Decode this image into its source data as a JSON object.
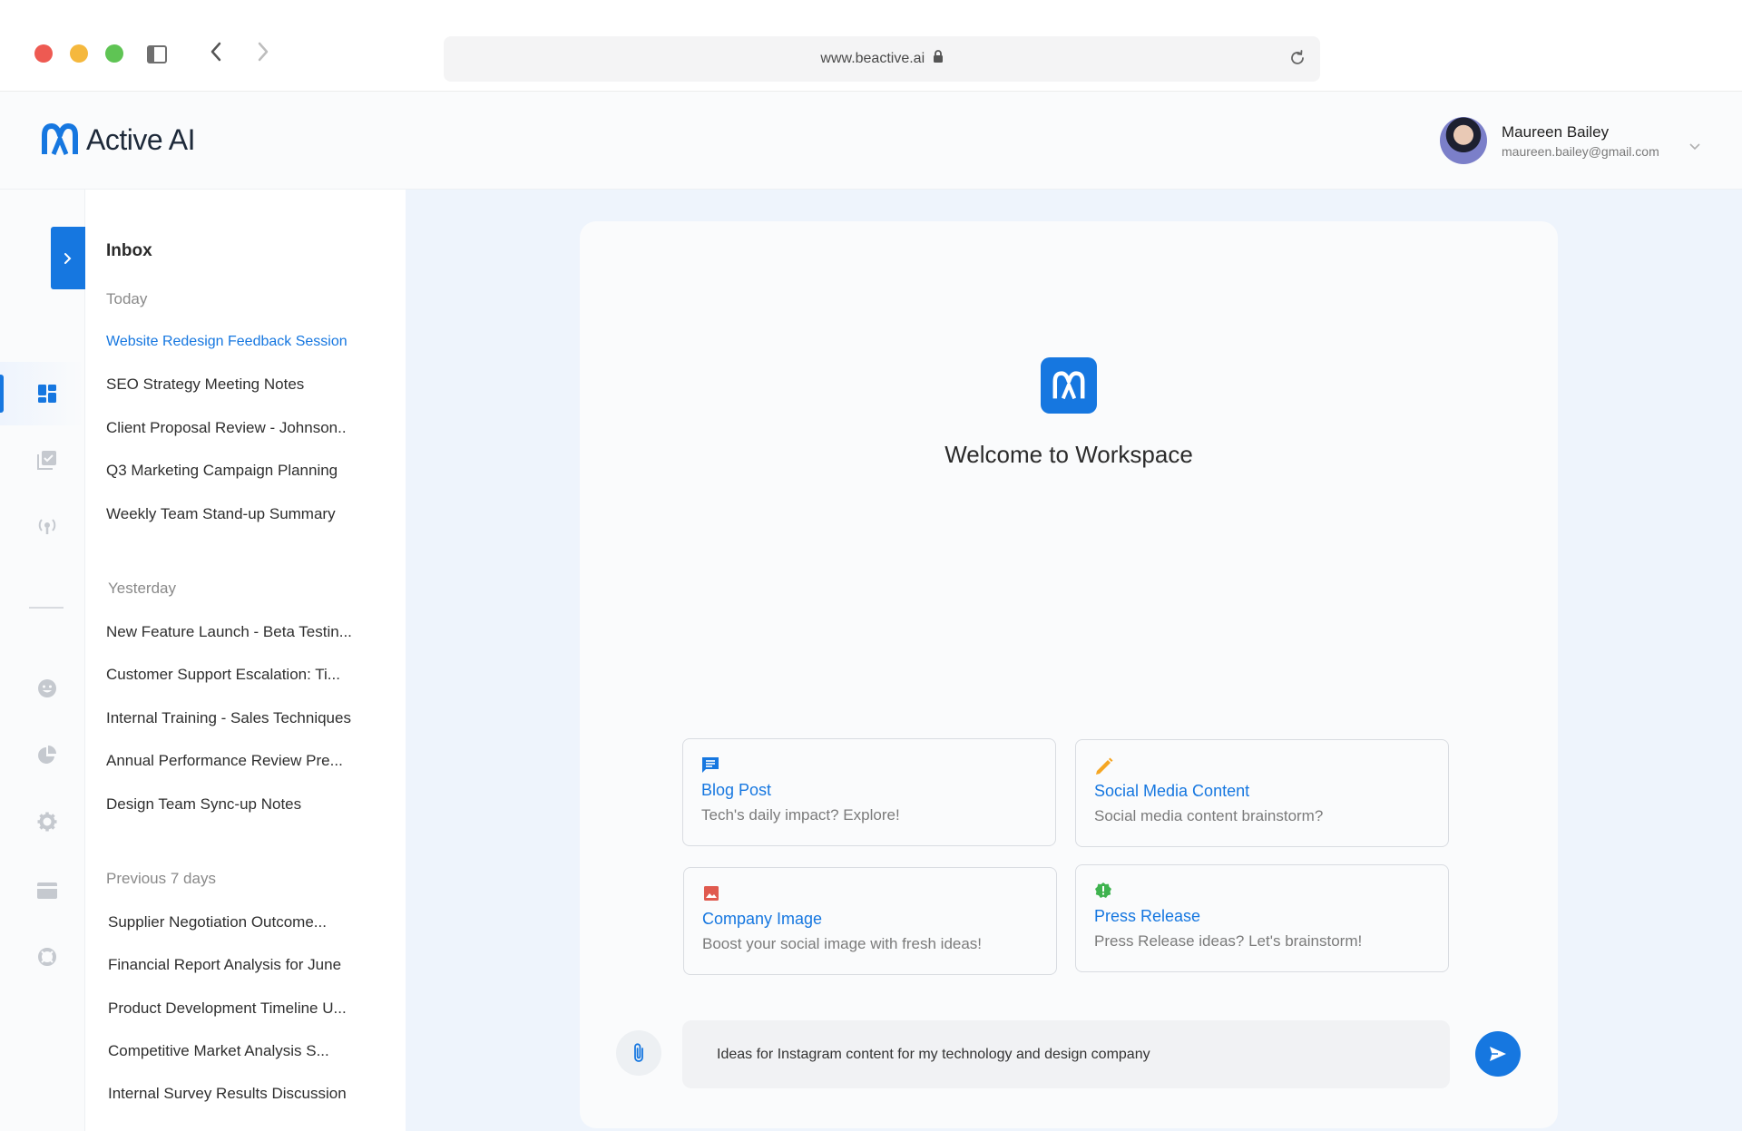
{
  "browser": {
    "url": "www.beactive.ai"
  },
  "header": {
    "brand_bold": "Active",
    "brand_light": " AI",
    "user": {
      "name": "Maureen Bailey",
      "email": "maureen.bailey@gmail.com"
    }
  },
  "rail": {
    "icons": [
      "dashboard-icon",
      "tasks-icon",
      "broadcast-icon",
      "emoji-icon",
      "pie-chart-icon",
      "settings-icon",
      "card-icon",
      "support-icon"
    ]
  },
  "inbox": {
    "title": "Inbox",
    "groups": [
      {
        "label": "Today",
        "items": [
          "Website Redesign Feedback Session",
          "SEO Strategy Meeting Notes",
          "Client Proposal Review - Johnson..",
          "Q3 Marketing Campaign Planning",
          "Weekly Team Stand-up Summary"
        ]
      },
      {
        "label": "Yesterday",
        "items": [
          "New Feature Launch - Beta Testin...",
          "Customer Support Escalation: Ti...",
          "Internal Training - Sales Techniques",
          "Annual Performance Review Pre...",
          "Design Team Sync-up Notes"
        ]
      },
      {
        "label": "Previous 7 days",
        "items": [
          "Supplier Negotiation Outcome...",
          "Financial Report Analysis for June",
          "Product Development Timeline U...",
          "Competitive Market Analysis S...",
          "Internal Survey Results Discussion"
        ]
      }
    ]
  },
  "workspace": {
    "title": "Welcome to Workspace",
    "suggestions": [
      {
        "title": "Blog Post",
        "subtitle": "Tech's daily impact? Explore!",
        "icon": "message-icon",
        "color": "#1677e0"
      },
      {
        "title": "Social Media Content",
        "subtitle": "Social media content brainstorm?",
        "icon": "pencil-icon",
        "color": "#f5a623"
      },
      {
        "title": "Company Image",
        "subtitle": "Boost your social image with fresh ideas!",
        "icon": "image-icon",
        "color": "#e05a4f"
      },
      {
        "title": "Press Release",
        "subtitle": "Press Release ideas? Let's brainstorm!",
        "icon": "badge-icon",
        "color": "#3fb34f"
      }
    ],
    "prompt_value": "Ideas for Instagram content for my technology and design company"
  },
  "colors": {
    "accent": "#1677e0",
    "main_bg": "#eef4fc"
  }
}
